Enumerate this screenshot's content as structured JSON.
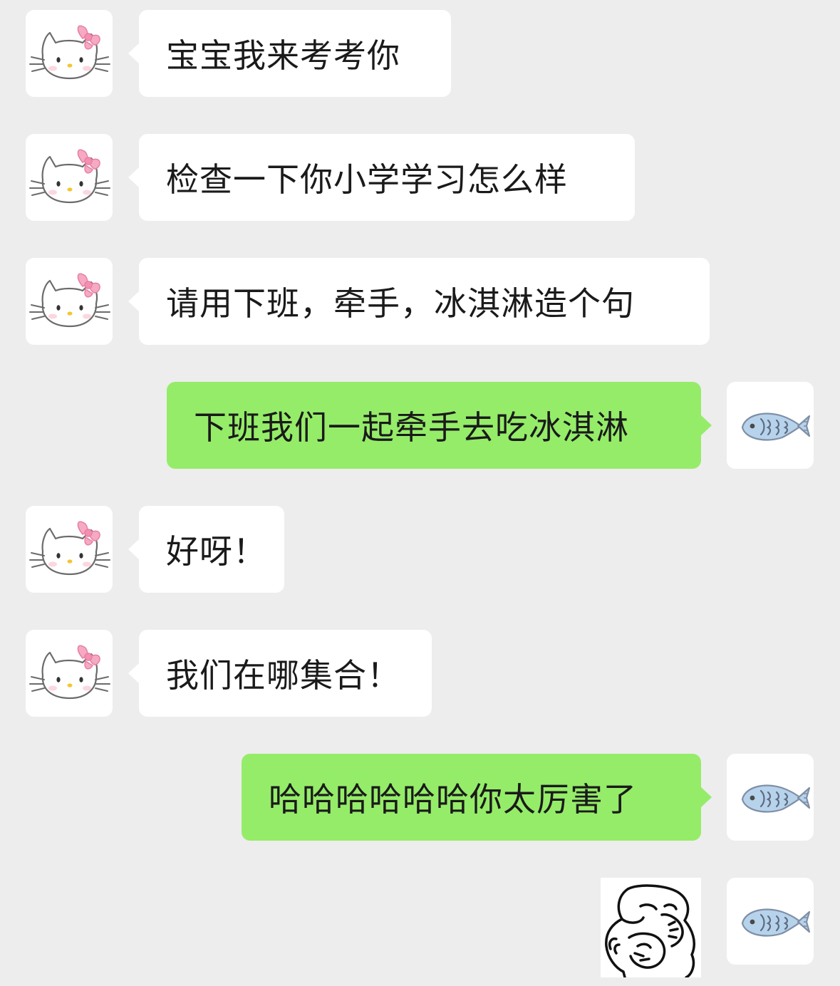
{
  "chat": {
    "messages": [
      {
        "sender": "contact",
        "avatar_icon": "hello-kitty-avatar-icon",
        "text": "宝宝我来考考你"
      },
      {
        "sender": "contact",
        "avatar_icon": "hello-kitty-avatar-icon",
        "text": "检查一下你小学学习怎么样"
      },
      {
        "sender": "contact",
        "avatar_icon": "hello-kitty-avatar-icon",
        "text": "请用下班，牵手，冰淇淋造个句"
      },
      {
        "sender": "self",
        "avatar_icon": "fish-avatar-icon",
        "text": "下班我们一起牵手去吃冰淇淋"
      },
      {
        "sender": "contact",
        "avatar_icon": "hello-kitty-avatar-icon",
        "text": "好呀！"
      },
      {
        "sender": "contact",
        "avatar_icon": "hello-kitty-avatar-icon",
        "text": "我们在哪集合！"
      },
      {
        "sender": "self",
        "avatar_icon": "fish-avatar-icon",
        "text": "哈哈哈哈哈哈你太厉害了"
      },
      {
        "sender": "self",
        "avatar_icon": "fish-avatar-icon",
        "type": "sticker",
        "sticker_icon": "laughing-face-sticker-icon"
      }
    ]
  },
  "colors": {
    "background": "#ededed",
    "incoming_bubble": "#ffffff",
    "outgoing_bubble": "#95ec69",
    "text": "#1a1a1a"
  }
}
